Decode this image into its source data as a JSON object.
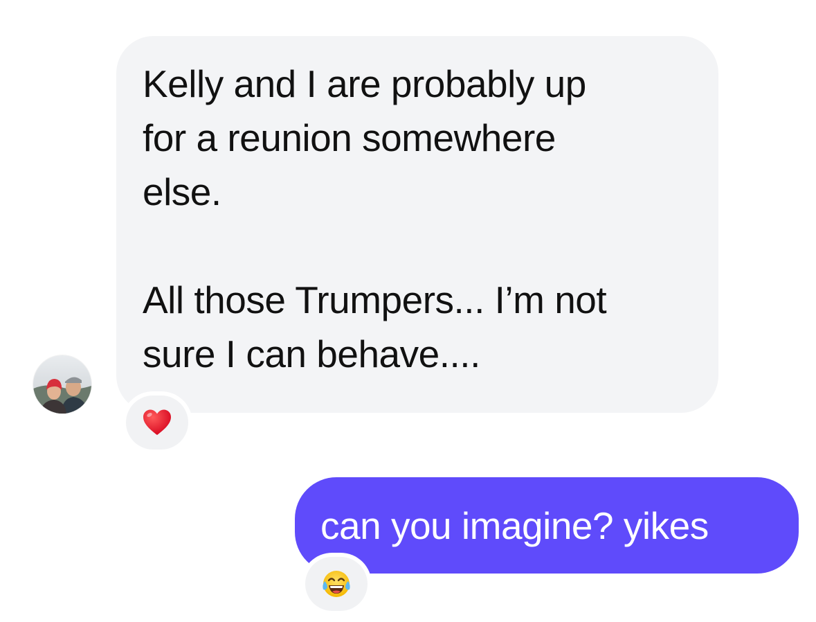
{
  "conversation": {
    "messages": [
      {
        "direction": "incoming",
        "text": "Kelly and I are probably up\nfor a reunion somewhere\nelse.\n\nAll those Trumpers... I’m not\nsure I can behave....",
        "reaction": {
          "icon": "red-heart-icon",
          "emoji": "❤️"
        }
      },
      {
        "direction": "outgoing",
        "text": "can you imagine? yikes",
        "reaction": {
          "icon": "tears-of-joy-icon",
          "emoji": "😂"
        }
      }
    ]
  },
  "colors": {
    "incoming_bubble": "#f3f4f6",
    "outgoing_bubble": "#5f4bfb",
    "incoming_text": "#111111",
    "outgoing_text": "#ffffff",
    "reaction_pill": "#f1f2f4"
  },
  "avatar": {
    "icon": "contact-avatar-photo"
  }
}
